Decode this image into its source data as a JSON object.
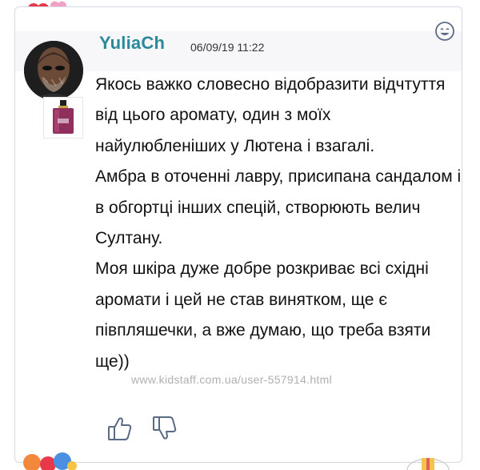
{
  "post": {
    "username": "YuliaCh",
    "timestamp": "06/09/19 11:22",
    "paragraphs": [
      "Якось важко словесно відобразити відчтуття від цього аромату, один з моїх найулюбленіших у Лютена і взагалі.",
      "Амбра в оточенні лавру, присипана сандалом і в обгортці інших спецій, створюють велич Султану.",
      "Моя шкіра дуже добре розкриває всі східні аромати і цей не став винятком, ще є півпляшечки, а вже думаю, що треба взяти ще))"
    ]
  },
  "watermark": "www.kidstaff.com.ua/user-557914.html",
  "icons": {
    "avatar": "user-avatar",
    "thumbnail": "perfume-bottle-thumbnail",
    "smile": "smiley-face-icon",
    "like": "thumbs-up-icon",
    "dislike": "thumbs-down-icon",
    "balloons": "heart-balloons-icon"
  },
  "colors": {
    "username": "#2a8a9a",
    "border": "#d4d9e3",
    "icon": "#5a6a85"
  }
}
